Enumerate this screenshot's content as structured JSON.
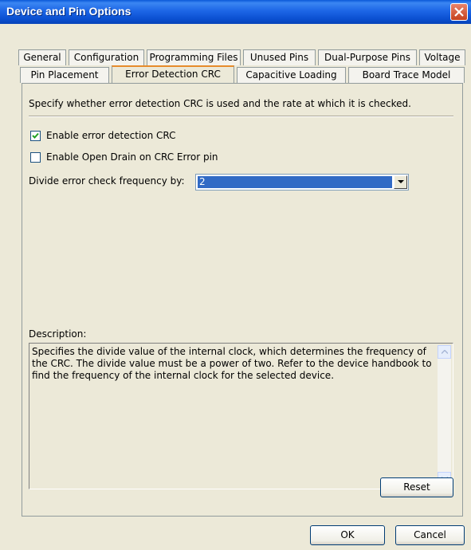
{
  "window": {
    "title": "Device and Pin Options"
  },
  "tabs_row1": [
    {
      "label": "General"
    },
    {
      "label": "Configuration"
    },
    {
      "label": "Programming Files"
    },
    {
      "label": "Unused Pins"
    },
    {
      "label": "Dual-Purpose Pins"
    },
    {
      "label": "Voltage"
    }
  ],
  "tabs_row2": [
    {
      "label": "Pin Placement"
    },
    {
      "label": "Error Detection CRC",
      "active": true
    },
    {
      "label": "Capacitive Loading"
    },
    {
      "label": "Board Trace Model"
    }
  ],
  "page": {
    "instruction": "Specify whether error detection CRC is used and the rate at which it is checked.",
    "enable_crc": {
      "label": "Enable error detection CRC",
      "checked": true
    },
    "open_drain": {
      "label": "Enable Open Drain on CRC Error pin",
      "checked": false
    },
    "divide": {
      "label": "Divide error check frequency by:",
      "value": "2"
    },
    "description_label": "Description:",
    "description_text": "Specifies the divide value of the internal clock, which determines the frequency of the CRC. The divide value must be a power of two. Refer to the device handbook to find the frequency of the internal clock for the selected device.",
    "reset_label": "Reset"
  },
  "footer": {
    "ok_label": "OK",
    "cancel_label": "Cancel"
  },
  "colors": {
    "title_blue": "#0a4fd0",
    "selection": "#316ac5",
    "dialog_bg": "#ece9d8",
    "active_tab_accent": "#e68b2c"
  }
}
